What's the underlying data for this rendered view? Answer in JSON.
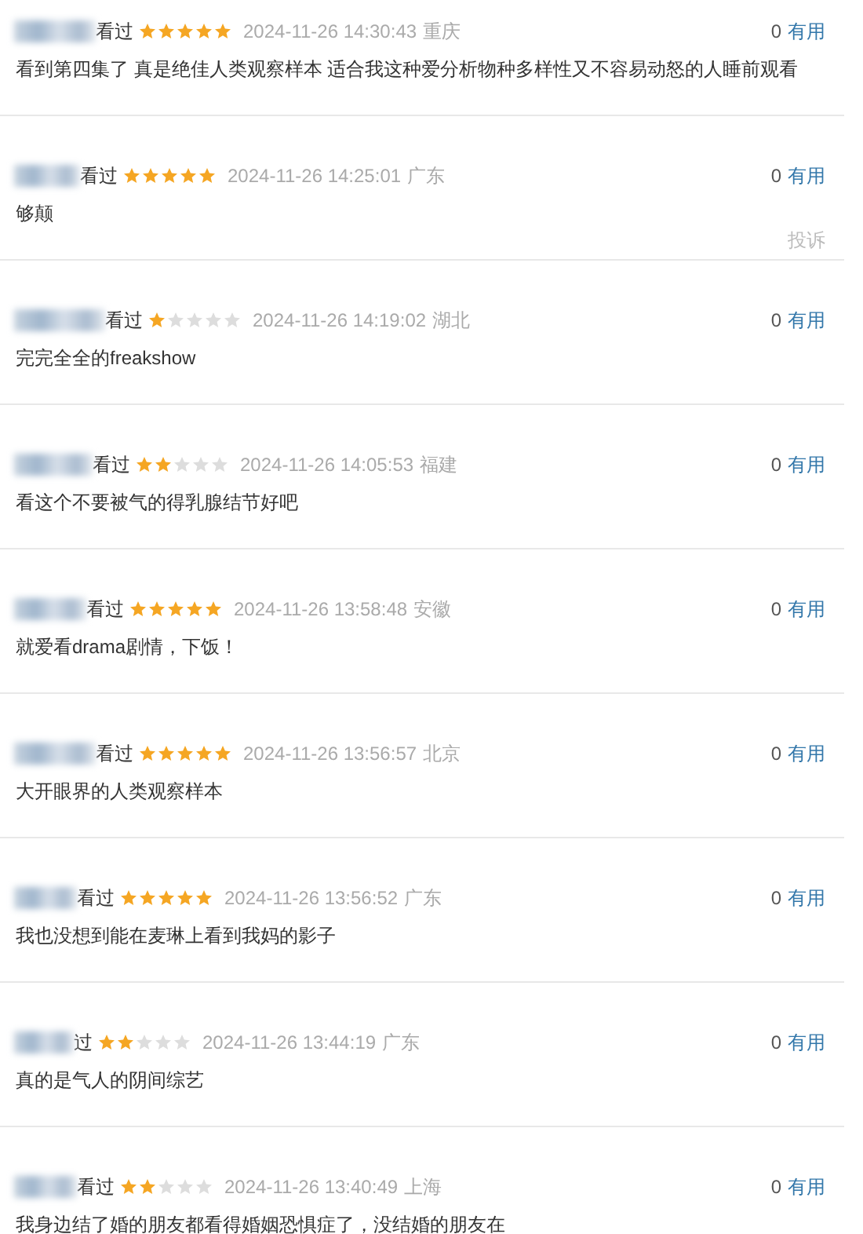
{
  "reviews": [
    {
      "watched": "看过",
      "stars": 5,
      "time": "2024-11-26 14:30:43",
      "location": "重庆",
      "comment": "看到第四集了 真是绝佳人类观察样本 适合我这种爱分析物种多样性又不容易动怒的人睡前观看",
      "useful_count": "0",
      "useful_label": "有用"
    },
    {
      "watched": "看过",
      "stars": 5,
      "time": "2024-11-26 14:25:01",
      "location": "广东",
      "comment": "够颠",
      "useful_count": "0",
      "useful_label": "有用",
      "complaint": "投诉"
    },
    {
      "watched": "看过",
      "stars": 1,
      "time": "2024-11-26 14:19:02",
      "location": "湖北",
      "comment": "完完全全的freakshow",
      "useful_count": "0",
      "useful_label": "有用"
    },
    {
      "watched": "看过",
      "stars": 2,
      "time": "2024-11-26 14:05:53",
      "location": "福建",
      "comment": "看这个不要被气的得乳腺结节好吧",
      "useful_count": "0",
      "useful_label": "有用"
    },
    {
      "watched": "看过",
      "stars": 5,
      "time": "2024-11-26 13:58:48",
      "location": "安徽",
      "comment": "就爱看drama剧情，下饭！",
      "useful_count": "0",
      "useful_label": "有用"
    },
    {
      "watched": "看过",
      "stars": 5,
      "time": "2024-11-26 13:56:57",
      "location": "北京",
      "comment": "大开眼界的人类观察样本",
      "useful_count": "0",
      "useful_label": "有用"
    },
    {
      "watched": "看过",
      "stars": 5,
      "time": "2024-11-26 13:56:52",
      "location": "广东",
      "comment": "我也没想到能在麦琳上看到我妈的影子",
      "useful_count": "0",
      "useful_label": "有用"
    },
    {
      "watched": "过",
      "stars": 2,
      "time": "2024-11-26 13:44:19",
      "location": "广东",
      "comment": "真的是气人的阴间综艺",
      "useful_count": "0",
      "useful_label": "有用"
    },
    {
      "watched": "看过",
      "stars": 2,
      "time": "2024-11-26 13:40:49",
      "location": "上海",
      "comment": "我身边结了婚的朋友都看得婚姻恐惧症了，没结婚的朋友在",
      "useful_count": "0",
      "useful_label": "有用"
    }
  ]
}
